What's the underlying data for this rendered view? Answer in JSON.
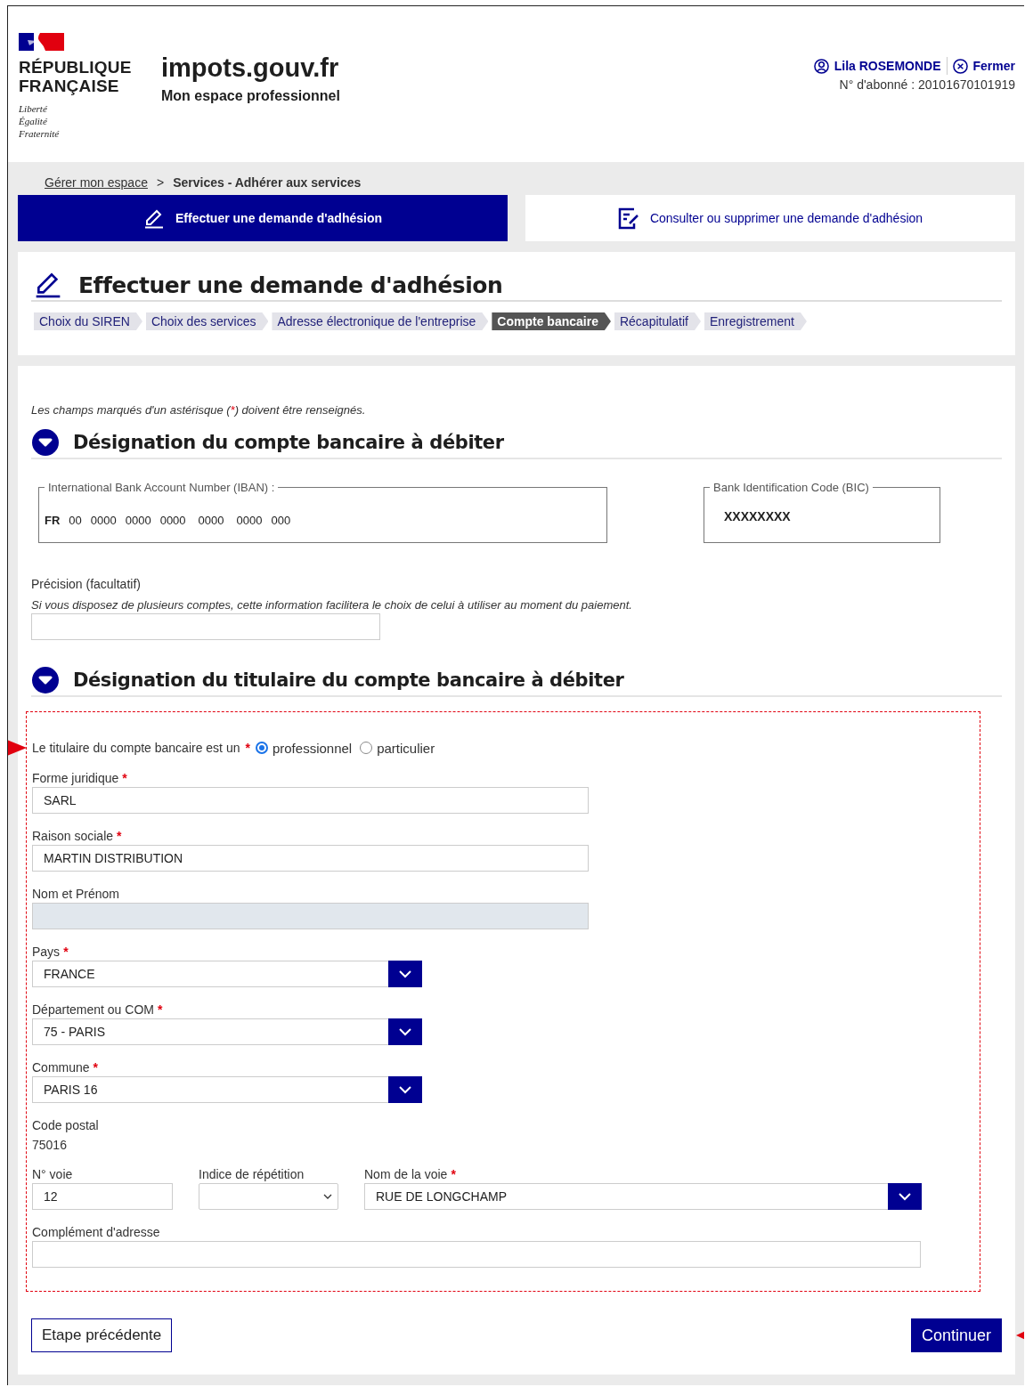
{
  "header": {
    "republic": [
      "RÉPUBLIQUE",
      "FRANÇAISE"
    ],
    "motto": [
      "Liberté",
      "Égalité",
      "Fraternité"
    ],
    "site": "impots.gouv.fr",
    "subtitle": "Mon espace professionnel",
    "user": "Lila ROSEMONDE",
    "logout": "Fermer",
    "subscriber": "N° d'abonné : 20101670101919"
  },
  "breadcrumb": {
    "link": "Gérer mon espace",
    "separator": ">",
    "current": "Services - Adhérer aux services"
  },
  "tabs": [
    {
      "label": "Effectuer une demande d'adhésion",
      "selected": true
    },
    {
      "label": "Consulter ou supprimer une demande d'adhésion",
      "selected": false
    }
  ],
  "title": "Effectuer une demande d'adhésion",
  "steps": [
    {
      "label": "Choix du SIREN",
      "selected": false
    },
    {
      "label": "Choix des services",
      "selected": false
    },
    {
      "label": "Adresse électronique de l'entreprise",
      "selected": false
    },
    {
      "label": "Compte bancaire",
      "selected": true
    },
    {
      "label": "Récapitulatif",
      "selected": false
    },
    {
      "label": "Enregistrement",
      "selected": false
    }
  ],
  "note": {
    "before": "Les champs marqués d'un astérisque (",
    "mark": "*",
    "after": ") doivent être renseignés."
  },
  "section_account": {
    "heading": "Désignation du compte bancaire à débiter",
    "iban": {
      "legend": "International Bank Account Number (IBAN) :",
      "parts": [
        "FR",
        "00",
        "0000",
        "0000",
        "0000",
        "0000",
        "0000",
        "000"
      ]
    },
    "bic": {
      "legend": "Bank Identification Code (BIC)",
      "value": "XXXXXXXX"
    },
    "precision": {
      "label": "Précision (facultatif)",
      "hint": "Si vous disposez de plusieurs comptes, cette information facilitera le choix de celui à utiliser au moment du paiement."
    }
  },
  "section_holder": {
    "heading": "Désignation du titulaire du compte bancaire à débiter",
    "rows": [
      [
        {
          "kind": "radio",
          "label": "Le titulaire du compte bancaire est un",
          "mark": "*",
          "options": [
            {
              "label": "professionnel",
              "selected": true
            },
            {
              "label": "particulier",
              "selected": false
            }
          ]
        }
      ],
      [
        {
          "kind": "text",
          "label": "Forme juridique",
          "mark": "*",
          "value": "SARL",
          "disabled": false
        }
      ],
      [
        {
          "kind": "text",
          "label": "Raison sociale",
          "mark": "*",
          "value": "MARTIN DISTRIBUTION",
          "disabled": false
        }
      ],
      [
        {
          "kind": "text",
          "label": "Nom et Prénom",
          "disabled": true
        }
      ],
      [
        {
          "kind": "select",
          "label": "Pays",
          "mark": "*",
          "value": "FRANCE"
        }
      ],
      [
        {
          "kind": "select",
          "label": "Département ou COM",
          "mark": "*",
          "value": "75 - PARIS"
        }
      ],
      [
        {
          "kind": "select",
          "label": "Commune",
          "mark": "*",
          "value": "PARIS 16"
        }
      ],
      [
        {
          "kind": "static",
          "label": "Code postal",
          "value": "75016"
        }
      ],
      [
        {
          "kind": "text",
          "label": "N° voie",
          "value": "12",
          "disabled": false
        },
        {
          "kind": "dropdown",
          "label": "Indice de répétition"
        },
        {
          "kind": "select",
          "label": "Nom de la voie",
          "mark": "*",
          "value": "RUE DE LONGCHAMP"
        }
      ],
      [
        {
          "kind": "text",
          "label": "Complément d'adresse",
          "disabled": false
        }
      ]
    ]
  },
  "buttons": {
    "back": "Etape précédente",
    "next": "Continuer"
  }
}
